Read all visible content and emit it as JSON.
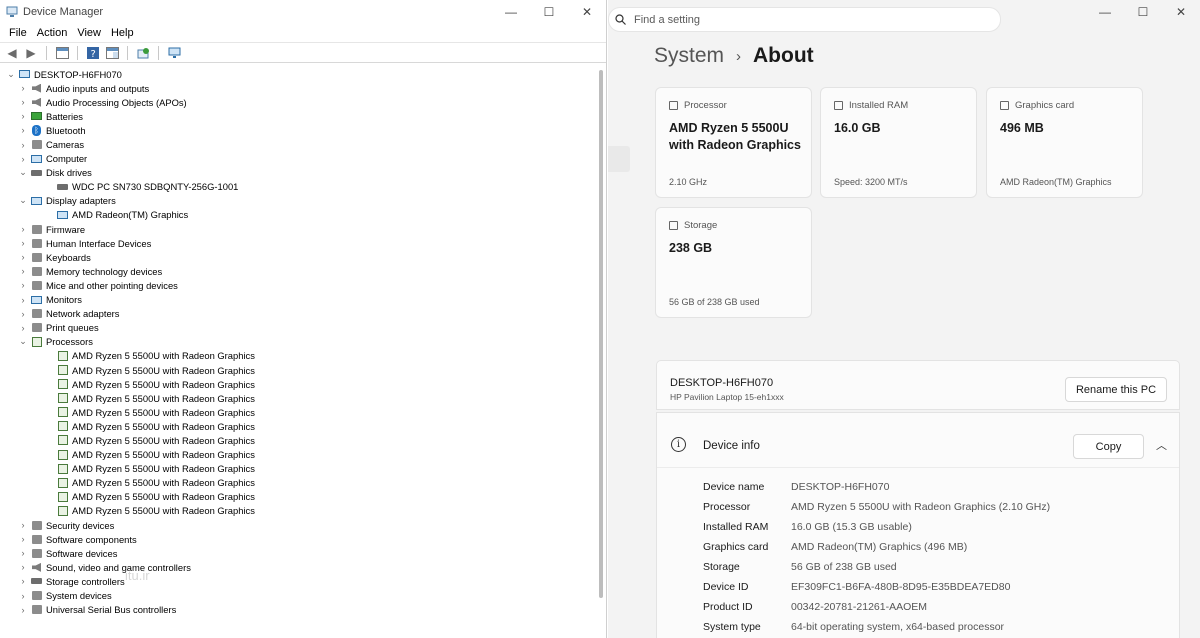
{
  "device_manager": {
    "title": "Device Manager",
    "menu": [
      "File",
      "Action",
      "View",
      "Help"
    ],
    "watermark": "itu.ir",
    "tree": [
      {
        "label": "DESKTOP-H6FH070",
        "level": 0,
        "expand": "⌄",
        "icon": "computer-icon"
      },
      {
        "label": "Audio inputs and outputs",
        "level": 1,
        "expand": "›",
        "icon": "speaker-icon"
      },
      {
        "label": "Audio Processing Objects (APOs)",
        "level": 1,
        "expand": "›",
        "icon": "speaker-icon"
      },
      {
        "label": "Batteries",
        "level": 1,
        "expand": "›",
        "icon": "battery-icon"
      },
      {
        "label": "Bluetooth",
        "level": 1,
        "expand": "›",
        "icon": "bluetooth-icon"
      },
      {
        "label": "Cameras",
        "level": 1,
        "expand": "›",
        "icon": "camera-icon"
      },
      {
        "label": "Computer",
        "level": 1,
        "expand": "›",
        "icon": "computer-icon"
      },
      {
        "label": "Disk drives",
        "level": 1,
        "expand": "⌄",
        "icon": "disk-icon"
      },
      {
        "label": "WDC PC SN730 SDBQNTY-256G-1001",
        "level": 2,
        "expand": "",
        "icon": "disk-icon"
      },
      {
        "label": "Display adapters",
        "level": 1,
        "expand": "⌄",
        "icon": "monitor-icon"
      },
      {
        "label": "AMD Radeon(TM) Graphics",
        "level": 2,
        "expand": "",
        "icon": "monitor-icon"
      },
      {
        "label": "Firmware",
        "level": 1,
        "expand": "›",
        "icon": "firmware-icon"
      },
      {
        "label": "Human Interface Devices",
        "level": 1,
        "expand": "›",
        "icon": "hid-icon"
      },
      {
        "label": "Keyboards",
        "level": 1,
        "expand": "›",
        "icon": "keyboard-icon"
      },
      {
        "label": "Memory technology devices",
        "level": 1,
        "expand": "›",
        "icon": "memory-icon"
      },
      {
        "label": "Mice and other pointing devices",
        "level": 1,
        "expand": "›",
        "icon": "mouse-icon"
      },
      {
        "label": "Monitors",
        "level": 1,
        "expand": "›",
        "icon": "monitor-icon"
      },
      {
        "label": "Network adapters",
        "level": 1,
        "expand": "›",
        "icon": "network-icon"
      },
      {
        "label": "Print queues",
        "level": 1,
        "expand": "›",
        "icon": "printer-icon"
      },
      {
        "label": "Processors",
        "level": 1,
        "expand": "⌄",
        "icon": "processor-icon"
      },
      {
        "label": "AMD Ryzen 5 5500U with Radeon Graphics",
        "level": 2,
        "expand": "",
        "icon": "processor-icon"
      },
      {
        "label": "AMD Ryzen 5 5500U with Radeon Graphics",
        "level": 2,
        "expand": "",
        "icon": "processor-icon"
      },
      {
        "label": "AMD Ryzen 5 5500U with Radeon Graphics",
        "level": 2,
        "expand": "",
        "icon": "processor-icon"
      },
      {
        "label": "AMD Ryzen 5 5500U with Radeon Graphics",
        "level": 2,
        "expand": "",
        "icon": "processor-icon"
      },
      {
        "label": "AMD Ryzen 5 5500U with Radeon Graphics",
        "level": 2,
        "expand": "",
        "icon": "processor-icon"
      },
      {
        "label": "AMD Ryzen 5 5500U with Radeon Graphics",
        "level": 2,
        "expand": "",
        "icon": "processor-icon"
      },
      {
        "label": "AMD Ryzen 5 5500U with Radeon Graphics",
        "level": 2,
        "expand": "",
        "icon": "processor-icon"
      },
      {
        "label": "AMD Ryzen 5 5500U with Radeon Graphics",
        "level": 2,
        "expand": "",
        "icon": "processor-icon"
      },
      {
        "label": "AMD Ryzen 5 5500U with Radeon Graphics",
        "level": 2,
        "expand": "",
        "icon": "processor-icon"
      },
      {
        "label": "AMD Ryzen 5 5500U with Radeon Graphics",
        "level": 2,
        "expand": "",
        "icon": "processor-icon"
      },
      {
        "label": "AMD Ryzen 5 5500U with Radeon Graphics",
        "level": 2,
        "expand": "",
        "icon": "processor-icon"
      },
      {
        "label": "AMD Ryzen 5 5500U with Radeon Graphics",
        "level": 2,
        "expand": "",
        "icon": "processor-icon"
      },
      {
        "label": "Security devices",
        "level": 1,
        "expand": "›",
        "icon": "security-icon"
      },
      {
        "label": "Software components",
        "level": 1,
        "expand": "›",
        "icon": "software-icon"
      },
      {
        "label": "Software devices",
        "level": 1,
        "expand": "›",
        "icon": "software-icon"
      },
      {
        "label": "Sound, video and game controllers",
        "level": 1,
        "expand": "›",
        "icon": "speaker-icon"
      },
      {
        "label": "Storage controllers",
        "level": 1,
        "expand": "›",
        "icon": "storage-icon"
      },
      {
        "label": "System devices",
        "level": 1,
        "expand": "›",
        "icon": "system-icon"
      },
      {
        "label": "Universal Serial Bus controllers",
        "level": 1,
        "expand": "›",
        "icon": "usb-icon"
      }
    ]
  },
  "settings": {
    "search_placeholder": "Find a setting",
    "breadcrumb_root": "System",
    "breadcrumb_sep": "›",
    "page_title": "About",
    "cards": {
      "processor": {
        "label": "Processor",
        "value": "AMD Ryzen 5 5500U with Radeon Graphics",
        "sub": "2.10 GHz"
      },
      "ram": {
        "label": "Installed RAM",
        "value": "16.0 GB",
        "sub": "Speed: 3200 MT/s"
      },
      "graphics": {
        "label": "Graphics card",
        "value": "496 MB",
        "sub": "AMD Radeon(TM) Graphics"
      },
      "storage": {
        "label": "Storage",
        "value": "238 GB",
        "sub": "56 GB of 238 GB used"
      }
    },
    "pc": {
      "name": "DESKTOP-H6FH070",
      "model": "HP Pavilion Laptop 15-eh1xxx",
      "rename_label": "Rename this PC"
    },
    "device_info": {
      "title": "Device info",
      "copy_label": "Copy",
      "specs": [
        {
          "k": "Device name",
          "v": "DESKTOP-H6FH070"
        },
        {
          "k": "Processor",
          "v": "AMD Ryzen 5 5500U with Radeon Graphics (2.10 GHz)"
        },
        {
          "k": "Installed RAM",
          "v": "16.0 GB (15.3 GB usable)"
        },
        {
          "k": "Graphics card",
          "v": "AMD Radeon(TM) Graphics (496 MB)"
        },
        {
          "k": "Storage",
          "v": "56 GB of 238 GB used"
        },
        {
          "k": "Device ID",
          "v": "EF309FC1-B6FA-480B-8D95-E35BDEA7ED80"
        },
        {
          "k": "Product ID",
          "v": "00342-20781-21261-AAOEM"
        },
        {
          "k": "System type",
          "v": "64-bit operating system, x64-based processor"
        }
      ]
    }
  }
}
